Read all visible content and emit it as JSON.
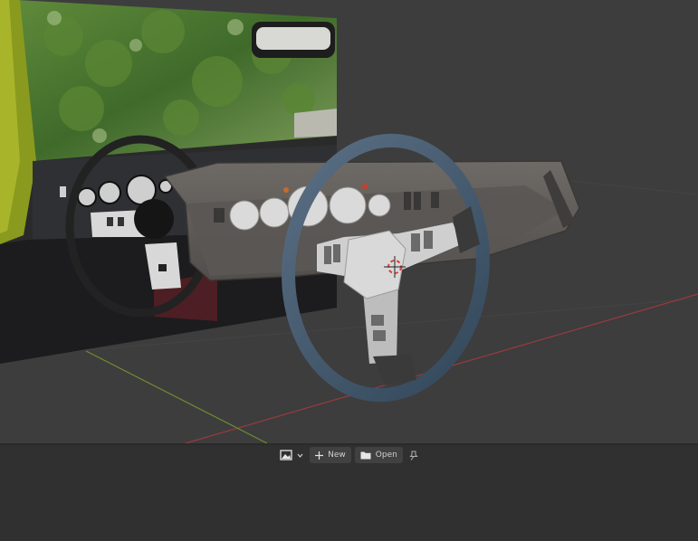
{
  "image_editor": {
    "header": {
      "editor_type_icon": "image-editor-icon",
      "new_label": "New",
      "open_label": "Open",
      "pin_icon": "pin-icon"
    }
  },
  "viewport": {
    "axis_colors": {
      "x": "#9a3a3f",
      "y": "#6f8b2e"
    },
    "scene": [
      "reference-photo-car-interior",
      "dashboard-3d-model",
      "steering-wheel-3d-model",
      "3d-cursor"
    ]
  }
}
